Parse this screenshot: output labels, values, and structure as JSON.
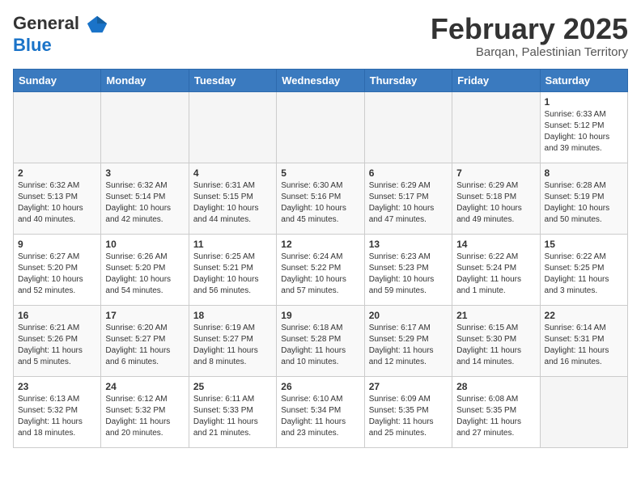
{
  "header": {
    "logo_line1": "General",
    "logo_line2": "Blue",
    "title": "February 2025",
    "subtitle": "Barqan, Palestinian Territory"
  },
  "weekdays": [
    "Sunday",
    "Monday",
    "Tuesday",
    "Wednesday",
    "Thursday",
    "Friday",
    "Saturday"
  ],
  "weeks": [
    [
      {
        "day": "",
        "info": ""
      },
      {
        "day": "",
        "info": ""
      },
      {
        "day": "",
        "info": ""
      },
      {
        "day": "",
        "info": ""
      },
      {
        "day": "",
        "info": ""
      },
      {
        "day": "",
        "info": ""
      },
      {
        "day": "1",
        "info": "Sunrise: 6:33 AM\nSunset: 5:12 PM\nDaylight: 10 hours\nand 39 minutes."
      }
    ],
    [
      {
        "day": "2",
        "info": "Sunrise: 6:32 AM\nSunset: 5:13 PM\nDaylight: 10 hours\nand 40 minutes."
      },
      {
        "day": "3",
        "info": "Sunrise: 6:32 AM\nSunset: 5:14 PM\nDaylight: 10 hours\nand 42 minutes."
      },
      {
        "day": "4",
        "info": "Sunrise: 6:31 AM\nSunset: 5:15 PM\nDaylight: 10 hours\nand 44 minutes."
      },
      {
        "day": "5",
        "info": "Sunrise: 6:30 AM\nSunset: 5:16 PM\nDaylight: 10 hours\nand 45 minutes."
      },
      {
        "day": "6",
        "info": "Sunrise: 6:29 AM\nSunset: 5:17 PM\nDaylight: 10 hours\nand 47 minutes."
      },
      {
        "day": "7",
        "info": "Sunrise: 6:29 AM\nSunset: 5:18 PM\nDaylight: 10 hours\nand 49 minutes."
      },
      {
        "day": "8",
        "info": "Sunrise: 6:28 AM\nSunset: 5:19 PM\nDaylight: 10 hours\nand 50 minutes."
      }
    ],
    [
      {
        "day": "9",
        "info": "Sunrise: 6:27 AM\nSunset: 5:20 PM\nDaylight: 10 hours\nand 52 minutes."
      },
      {
        "day": "10",
        "info": "Sunrise: 6:26 AM\nSunset: 5:20 PM\nDaylight: 10 hours\nand 54 minutes."
      },
      {
        "day": "11",
        "info": "Sunrise: 6:25 AM\nSunset: 5:21 PM\nDaylight: 10 hours\nand 56 minutes."
      },
      {
        "day": "12",
        "info": "Sunrise: 6:24 AM\nSunset: 5:22 PM\nDaylight: 10 hours\nand 57 minutes."
      },
      {
        "day": "13",
        "info": "Sunrise: 6:23 AM\nSunset: 5:23 PM\nDaylight: 10 hours\nand 59 minutes."
      },
      {
        "day": "14",
        "info": "Sunrise: 6:22 AM\nSunset: 5:24 PM\nDaylight: 11 hours\nand 1 minute."
      },
      {
        "day": "15",
        "info": "Sunrise: 6:22 AM\nSunset: 5:25 PM\nDaylight: 11 hours\nand 3 minutes."
      }
    ],
    [
      {
        "day": "16",
        "info": "Sunrise: 6:21 AM\nSunset: 5:26 PM\nDaylight: 11 hours\nand 5 minutes."
      },
      {
        "day": "17",
        "info": "Sunrise: 6:20 AM\nSunset: 5:27 PM\nDaylight: 11 hours\nand 6 minutes."
      },
      {
        "day": "18",
        "info": "Sunrise: 6:19 AM\nSunset: 5:27 PM\nDaylight: 11 hours\nand 8 minutes."
      },
      {
        "day": "19",
        "info": "Sunrise: 6:18 AM\nSunset: 5:28 PM\nDaylight: 11 hours\nand 10 minutes."
      },
      {
        "day": "20",
        "info": "Sunrise: 6:17 AM\nSunset: 5:29 PM\nDaylight: 11 hours\nand 12 minutes."
      },
      {
        "day": "21",
        "info": "Sunrise: 6:15 AM\nSunset: 5:30 PM\nDaylight: 11 hours\nand 14 minutes."
      },
      {
        "day": "22",
        "info": "Sunrise: 6:14 AM\nSunset: 5:31 PM\nDaylight: 11 hours\nand 16 minutes."
      }
    ],
    [
      {
        "day": "23",
        "info": "Sunrise: 6:13 AM\nSunset: 5:32 PM\nDaylight: 11 hours\nand 18 minutes."
      },
      {
        "day": "24",
        "info": "Sunrise: 6:12 AM\nSunset: 5:32 PM\nDaylight: 11 hours\nand 20 minutes."
      },
      {
        "day": "25",
        "info": "Sunrise: 6:11 AM\nSunset: 5:33 PM\nDaylight: 11 hours\nand 21 minutes."
      },
      {
        "day": "26",
        "info": "Sunrise: 6:10 AM\nSunset: 5:34 PM\nDaylight: 11 hours\nand 23 minutes."
      },
      {
        "day": "27",
        "info": "Sunrise: 6:09 AM\nSunset: 5:35 PM\nDaylight: 11 hours\nand 25 minutes."
      },
      {
        "day": "28",
        "info": "Sunrise: 6:08 AM\nSunset: 5:35 PM\nDaylight: 11 hours\nand 27 minutes."
      },
      {
        "day": "",
        "info": ""
      }
    ]
  ]
}
